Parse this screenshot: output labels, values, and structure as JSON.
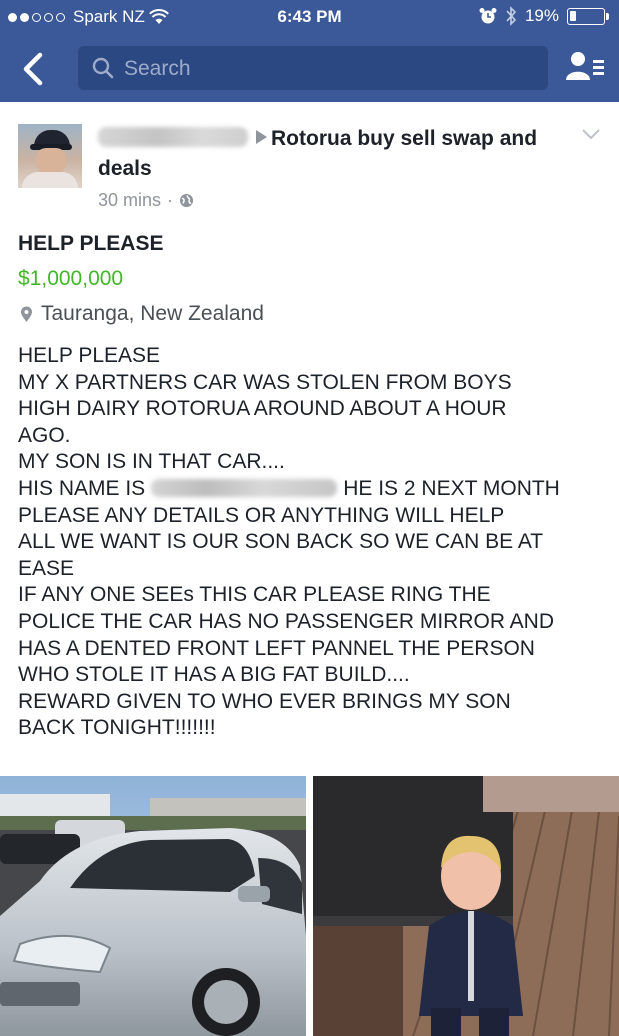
{
  "status_bar": {
    "carrier": "Spark NZ",
    "time": "6:43 PM",
    "battery": "19%",
    "battery_level": 0.19,
    "icons": [
      "signal-dots-icon",
      "wifi-icon",
      "alarm-icon",
      "bluetooth-icon",
      "battery-icon"
    ]
  },
  "nav": {
    "search_placeholder": "Search",
    "icons": [
      "back-chevron-icon",
      "search-icon",
      "friends-list-icon"
    ]
  },
  "post": {
    "group_name": "Rotorua buy sell swap and deals",
    "time_ago": "30 mins",
    "separator": "·",
    "privacy_icon": "globe-icon",
    "title": "HELP PLEASE",
    "price": "$1,000,000",
    "location": "Tauranga, New Zealand",
    "price_color": "#42b72a",
    "body": {
      "l1": "HELP PLEASE",
      "l2": "MY X PARTNERS CAR WAS STOLEN FROM BOYS",
      "l3": "HIGH DAIRY ROTORUA AROUND ABOUT A HOUR",
      "l4": "AGO.",
      "l5": "MY SON IS IN THAT CAR....",
      "l6_start": "HIS NAME IS",
      "l6_end": "HE IS 2 NEXT MONTH",
      "l7": "PLEASE ANY DETAILS OR ANYTHING WILL HELP",
      "l8": "ALL WE WANT IS OUR SON BACK SO WE CAN BE AT",
      "l9": "EASE",
      "l10": "IF ANY ONE SEEs THIS CAR PLEASE RING THE",
      "l11": "POLICE THE CAR HAS NO PASSENGER MIRROR AND",
      "l12": "HAS A DENTED FRONT LEFT PANNEL THE PERSON",
      "l13": "WHO STOLE IT HAS A BIG FAT BUILD....",
      "l14": "REWARD GIVEN TO WHO EVER BRINGS MY SON",
      "l15": "BACK TONIGHT!!!!!!!"
    }
  },
  "colors": {
    "facebook_blue": "#3b5998",
    "search_field": "#2c4882",
    "meta_gray": "#90949c"
  }
}
